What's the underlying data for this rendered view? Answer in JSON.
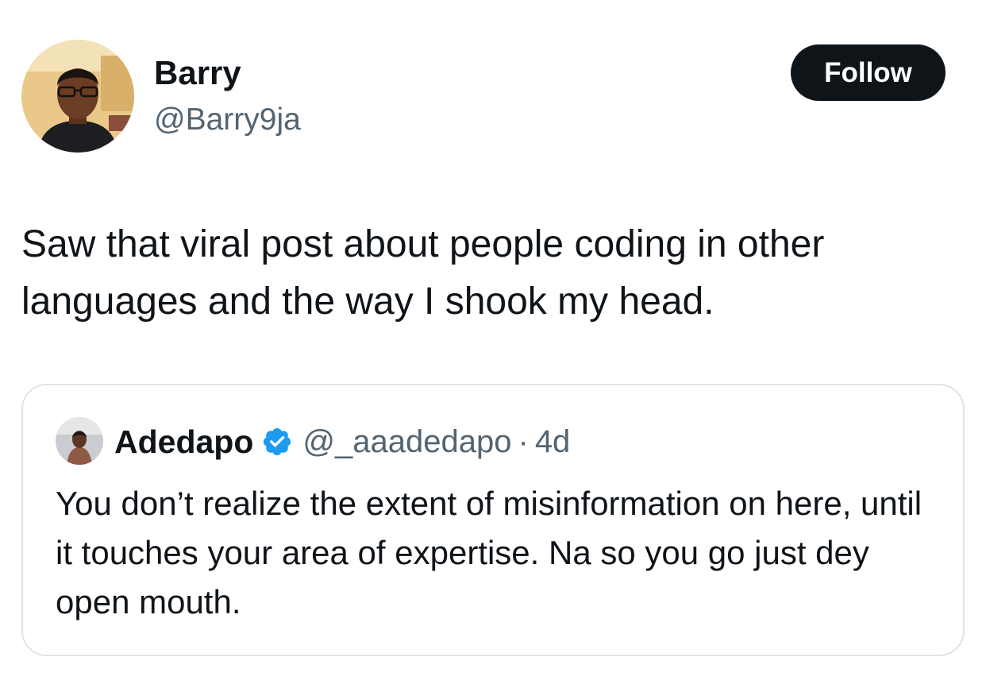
{
  "author": {
    "name": "Barry",
    "handle": "@Barry9ja",
    "avatar_icon": "profile-photo"
  },
  "follow_button": {
    "label": "Follow"
  },
  "tweet": {
    "text": "Saw that viral post about people coding in other languages and the way I shook my head."
  },
  "quoted_tweet": {
    "name": "Adedapo",
    "handle": "@_aaadedapo",
    "separator": "·",
    "time": "4d",
    "verified": true,
    "verified_color": "#1d9bf0",
    "text": "You don’t realize the extent of misinformation on here, until it touches your area of expertise. Na so you go just dey open mouth."
  },
  "colors": {
    "primary_text": "#0f1419",
    "secondary_text": "#536471",
    "button_bg": "#0f1419",
    "border": "#dfe3e7"
  }
}
